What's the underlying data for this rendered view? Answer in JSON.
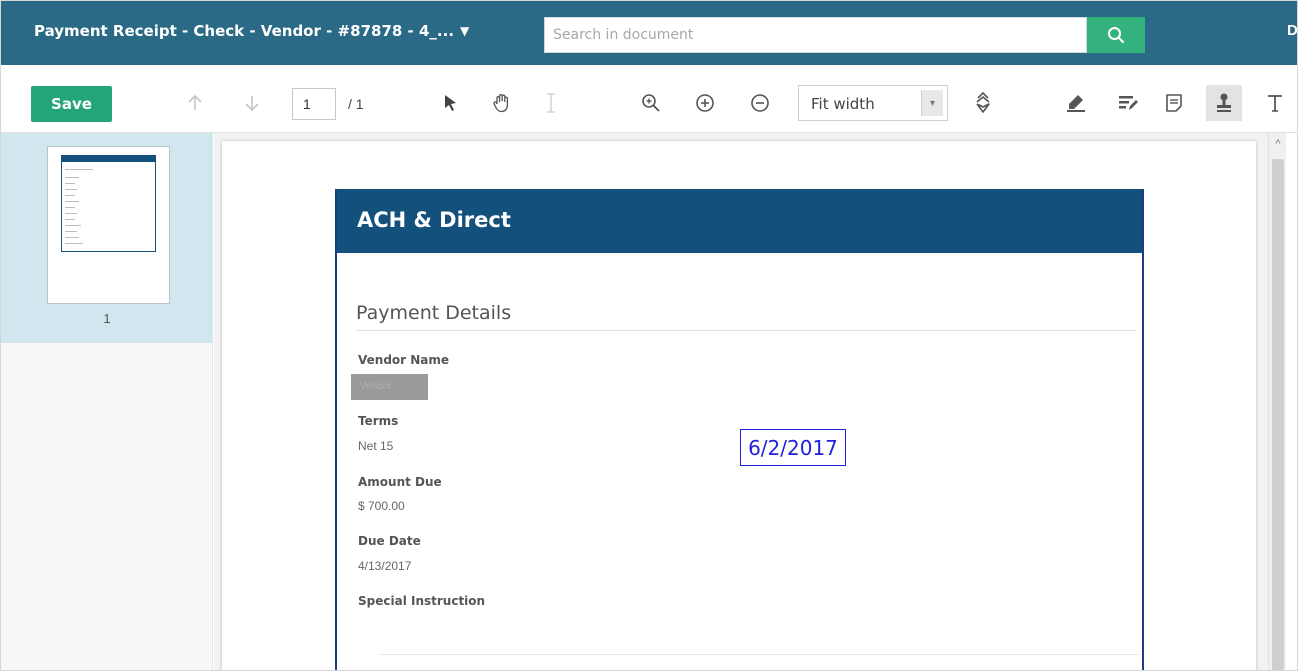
{
  "header": {
    "title": "Payment Receipt - Check - Vendor - #87878 - 4_...",
    "search_placeholder": "Search in document",
    "edge_char": "D"
  },
  "toolbar": {
    "save_label": "Save",
    "page_current": "1",
    "page_total": "/ 1",
    "zoom_value": "Fit width"
  },
  "thumbnails": [
    {
      "number": "1"
    }
  ],
  "document": {
    "header_title": "ACH & Direct",
    "section_title": "Payment Details",
    "fields": {
      "vendor_name_label": "Vendor Name",
      "vendor_name_value": "Vendor",
      "terms_label": "Terms",
      "terms_value": "Net 15",
      "amount_due_label": "Amount Due",
      "amount_due_value": "$ 700.00",
      "due_date_label": "Due Date",
      "due_date_value": "4/13/2017",
      "special_instruction_label": "Special Instruction"
    },
    "stamp_text": "6/2/2017"
  },
  "colors": {
    "header_bg": "#2a6a86",
    "save_green": "#23a47a",
    "search_green": "#33b27d",
    "doc_header_blue": "#14507c",
    "stamp_blue": "#2020dd",
    "thumb_selected": "#d2e6f0"
  }
}
